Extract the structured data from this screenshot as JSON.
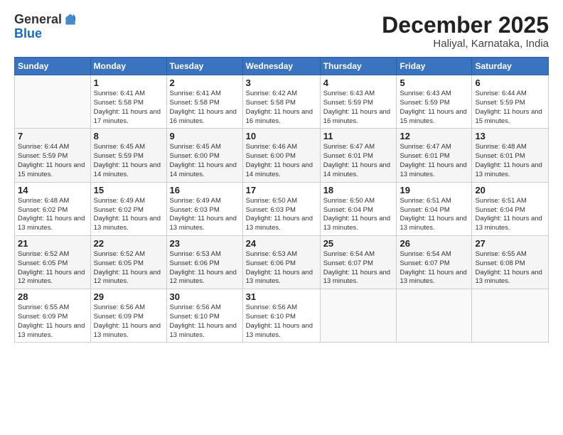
{
  "logo": {
    "general": "General",
    "blue": "Blue"
  },
  "title": "December 2025",
  "location": "Haliyal, Karnataka, India",
  "days": [
    "Sunday",
    "Monday",
    "Tuesday",
    "Wednesday",
    "Thursday",
    "Friday",
    "Saturday"
  ],
  "weeks": [
    [
      {
        "day": "",
        "sunrise": "",
        "sunset": "",
        "daylight": ""
      },
      {
        "day": "1",
        "sunrise": "Sunrise: 6:41 AM",
        "sunset": "Sunset: 5:58 PM",
        "daylight": "Daylight: 11 hours and 17 minutes."
      },
      {
        "day": "2",
        "sunrise": "Sunrise: 6:41 AM",
        "sunset": "Sunset: 5:58 PM",
        "daylight": "Daylight: 11 hours and 16 minutes."
      },
      {
        "day": "3",
        "sunrise": "Sunrise: 6:42 AM",
        "sunset": "Sunset: 5:58 PM",
        "daylight": "Daylight: 11 hours and 16 minutes."
      },
      {
        "day": "4",
        "sunrise": "Sunrise: 6:43 AM",
        "sunset": "Sunset: 5:59 PM",
        "daylight": "Daylight: 11 hours and 16 minutes."
      },
      {
        "day": "5",
        "sunrise": "Sunrise: 6:43 AM",
        "sunset": "Sunset: 5:59 PM",
        "daylight": "Daylight: 11 hours and 15 minutes."
      },
      {
        "day": "6",
        "sunrise": "Sunrise: 6:44 AM",
        "sunset": "Sunset: 5:59 PM",
        "daylight": "Daylight: 11 hours and 15 minutes."
      }
    ],
    [
      {
        "day": "7",
        "sunrise": "Sunrise: 6:44 AM",
        "sunset": "Sunset: 5:59 PM",
        "daylight": "Daylight: 11 hours and 15 minutes."
      },
      {
        "day": "8",
        "sunrise": "Sunrise: 6:45 AM",
        "sunset": "Sunset: 5:59 PM",
        "daylight": "Daylight: 11 hours and 14 minutes."
      },
      {
        "day": "9",
        "sunrise": "Sunrise: 6:45 AM",
        "sunset": "Sunset: 6:00 PM",
        "daylight": "Daylight: 11 hours and 14 minutes."
      },
      {
        "day": "10",
        "sunrise": "Sunrise: 6:46 AM",
        "sunset": "Sunset: 6:00 PM",
        "daylight": "Daylight: 11 hours and 14 minutes."
      },
      {
        "day": "11",
        "sunrise": "Sunrise: 6:47 AM",
        "sunset": "Sunset: 6:01 PM",
        "daylight": "Daylight: 11 hours and 14 minutes."
      },
      {
        "day": "12",
        "sunrise": "Sunrise: 6:47 AM",
        "sunset": "Sunset: 6:01 PM",
        "daylight": "Daylight: 11 hours and 13 minutes."
      },
      {
        "day": "13",
        "sunrise": "Sunrise: 6:48 AM",
        "sunset": "Sunset: 6:01 PM",
        "daylight": "Daylight: 11 hours and 13 minutes."
      }
    ],
    [
      {
        "day": "14",
        "sunrise": "Sunrise: 6:48 AM",
        "sunset": "Sunset: 6:02 PM",
        "daylight": "Daylight: 11 hours and 13 minutes."
      },
      {
        "day": "15",
        "sunrise": "Sunrise: 6:49 AM",
        "sunset": "Sunset: 6:02 PM",
        "daylight": "Daylight: 11 hours and 13 minutes."
      },
      {
        "day": "16",
        "sunrise": "Sunrise: 6:49 AM",
        "sunset": "Sunset: 6:03 PM",
        "daylight": "Daylight: 11 hours and 13 minutes."
      },
      {
        "day": "17",
        "sunrise": "Sunrise: 6:50 AM",
        "sunset": "Sunset: 6:03 PM",
        "daylight": "Daylight: 11 hours and 13 minutes."
      },
      {
        "day": "18",
        "sunrise": "Sunrise: 6:50 AM",
        "sunset": "Sunset: 6:04 PM",
        "daylight": "Daylight: 11 hours and 13 minutes."
      },
      {
        "day": "19",
        "sunrise": "Sunrise: 6:51 AM",
        "sunset": "Sunset: 6:04 PM",
        "daylight": "Daylight: 11 hours and 13 minutes."
      },
      {
        "day": "20",
        "sunrise": "Sunrise: 6:51 AM",
        "sunset": "Sunset: 6:04 PM",
        "daylight": "Daylight: 11 hours and 13 minutes."
      }
    ],
    [
      {
        "day": "21",
        "sunrise": "Sunrise: 6:52 AM",
        "sunset": "Sunset: 6:05 PM",
        "daylight": "Daylight: 11 hours and 12 minutes."
      },
      {
        "day": "22",
        "sunrise": "Sunrise: 6:52 AM",
        "sunset": "Sunset: 6:05 PM",
        "daylight": "Daylight: 11 hours and 12 minutes."
      },
      {
        "day": "23",
        "sunrise": "Sunrise: 6:53 AM",
        "sunset": "Sunset: 6:06 PM",
        "daylight": "Daylight: 11 hours and 12 minutes."
      },
      {
        "day": "24",
        "sunrise": "Sunrise: 6:53 AM",
        "sunset": "Sunset: 6:06 PM",
        "daylight": "Daylight: 11 hours and 13 minutes."
      },
      {
        "day": "25",
        "sunrise": "Sunrise: 6:54 AM",
        "sunset": "Sunset: 6:07 PM",
        "daylight": "Daylight: 11 hours and 13 minutes."
      },
      {
        "day": "26",
        "sunrise": "Sunrise: 6:54 AM",
        "sunset": "Sunset: 6:07 PM",
        "daylight": "Daylight: 11 hours and 13 minutes."
      },
      {
        "day": "27",
        "sunrise": "Sunrise: 6:55 AM",
        "sunset": "Sunset: 6:08 PM",
        "daylight": "Daylight: 11 hours and 13 minutes."
      }
    ],
    [
      {
        "day": "28",
        "sunrise": "Sunrise: 6:55 AM",
        "sunset": "Sunset: 6:09 PM",
        "daylight": "Daylight: 11 hours and 13 minutes."
      },
      {
        "day": "29",
        "sunrise": "Sunrise: 6:56 AM",
        "sunset": "Sunset: 6:09 PM",
        "daylight": "Daylight: 11 hours and 13 minutes."
      },
      {
        "day": "30",
        "sunrise": "Sunrise: 6:56 AM",
        "sunset": "Sunset: 6:10 PM",
        "daylight": "Daylight: 11 hours and 13 minutes."
      },
      {
        "day": "31",
        "sunrise": "Sunrise: 6:56 AM",
        "sunset": "Sunset: 6:10 PM",
        "daylight": "Daylight: 11 hours and 13 minutes."
      },
      {
        "day": "",
        "sunrise": "",
        "sunset": "",
        "daylight": ""
      },
      {
        "day": "",
        "sunrise": "",
        "sunset": "",
        "daylight": ""
      },
      {
        "day": "",
        "sunrise": "",
        "sunset": "",
        "daylight": ""
      }
    ]
  ]
}
